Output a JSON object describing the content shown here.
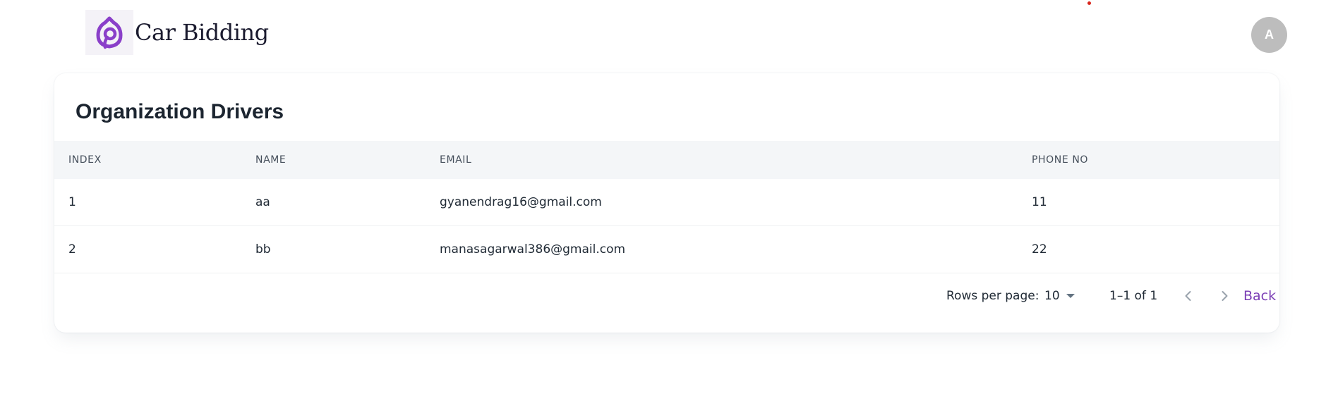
{
  "brand": {
    "name": "Car Bidding",
    "logo_icon": "car-bidding-logo-icon",
    "accent_color": "#8a3fc9"
  },
  "user": {
    "avatar_initial": "A"
  },
  "page": {
    "title": "Organization Drivers"
  },
  "table": {
    "columns": [
      "INDEX",
      "NAME",
      "EMAIL",
      "PHONE NO"
    ],
    "rows": [
      {
        "index": "1",
        "name": "aa",
        "email": "gyanendrag16@gmail.com",
        "phone": "11"
      },
      {
        "index": "2",
        "name": "bb",
        "email": "manasagarwal386@gmail.com",
        "phone": "22"
      }
    ]
  },
  "pagination": {
    "rows_per_page_label": "Rows per page:",
    "rows_per_page_value": "10",
    "range_text": "1–1 of 1",
    "prev_icon": "chevron-left-icon",
    "next_icon": "chevron-right-icon",
    "back_label": "Back"
  }
}
